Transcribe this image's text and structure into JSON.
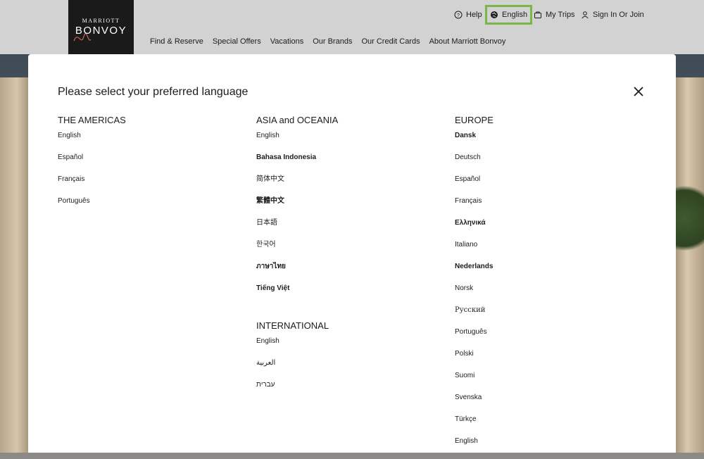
{
  "header": {
    "logo": {
      "top": "MARRIOTT",
      "main": "BONVOY"
    },
    "utility": {
      "help": "Help",
      "language": "English",
      "trips": "My Trips",
      "signin": "Sign In Or Join"
    },
    "nav": [
      "Find & Reserve",
      "Special Offers",
      "Vacations",
      "Our Brands",
      "Our Credit Cards",
      "About Marriott Bonvoy"
    ]
  },
  "modal": {
    "title": "Please select your preferred language",
    "columns": {
      "americas": {
        "heading": "THE AMERICAS",
        "items": [
          "English",
          "Español",
          "Français",
          "Português"
        ]
      },
      "asia": {
        "heading": "ASIA and OCEANIA",
        "items": [
          "English",
          "Bahasa Indonesia",
          "简体中文",
          "繁體中文",
          "日本語",
          "한국어",
          "ภาษาไทย",
          "Tiếng Việt"
        ]
      },
      "international": {
        "heading": "INTERNATIONAL",
        "items": [
          "English",
          "العربية",
          "עברית"
        ]
      },
      "europe": {
        "heading": "EUROPE",
        "items": [
          "Dansk",
          "Deutsch",
          "Español",
          "Français",
          "Ελληνικά",
          "Italiano",
          "Nederlands",
          "Norsk",
          "Русский",
          "Português",
          "Polski",
          "Suomi",
          "Svenska",
          "Türkçe",
          "English"
        ]
      }
    }
  },
  "colors": {
    "highlight": "#7ab648",
    "logo_bg": "#1a1a1a",
    "header_bg": "#d2d2d2"
  },
  "icons": {
    "help": "help-circle-icon",
    "language": "globe-icon",
    "trips": "suitcase-icon",
    "signin": "user-icon",
    "close": "close-icon"
  }
}
